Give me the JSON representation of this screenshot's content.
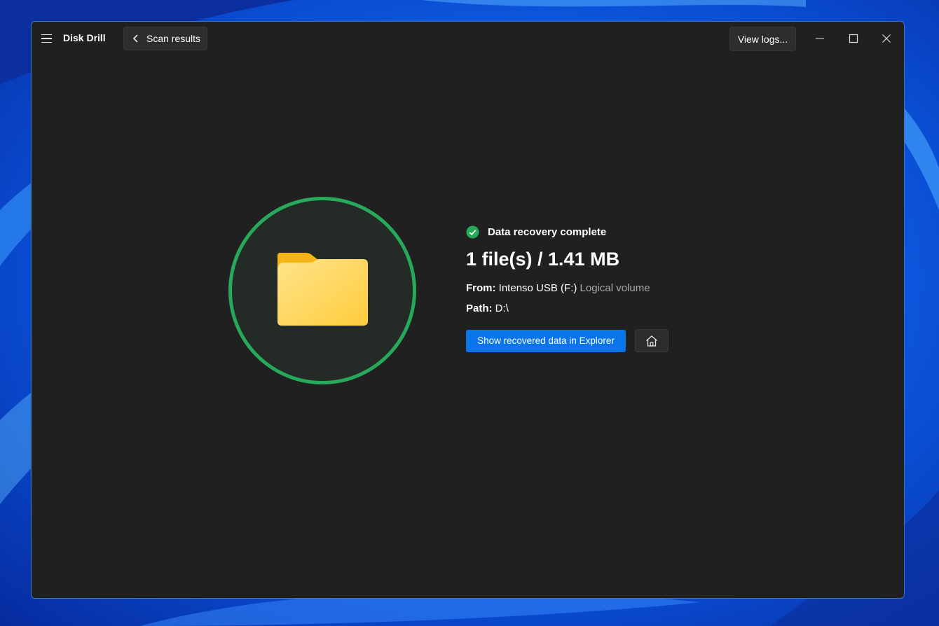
{
  "app": {
    "title": "Disk Drill"
  },
  "toolbar": {
    "back_label": "Scan results",
    "logs_label": "View logs..."
  },
  "result": {
    "status": "Data recovery complete",
    "headline": "1 file(s) / 1.41 MB",
    "from_label": "From:",
    "from_value": "Intenso USB (F:)",
    "from_type": "Logical volume",
    "path_label": "Path:",
    "path_value": "D:\\"
  },
  "actions": {
    "show_explorer_label": "Show recovered data in Explorer"
  },
  "icons": {
    "menu": "hamburger-icon",
    "back": "chevron-left-icon",
    "status": "check-circle-icon",
    "folder": "folder-icon",
    "home": "home-icon",
    "minimize": "minimize-icon",
    "maximize": "maximize-icon",
    "close": "close-icon"
  },
  "colors": {
    "accent": "#0a74eb",
    "success": "#27a85a",
    "window_bg": "#202020",
    "folder": "#ffd45c"
  }
}
